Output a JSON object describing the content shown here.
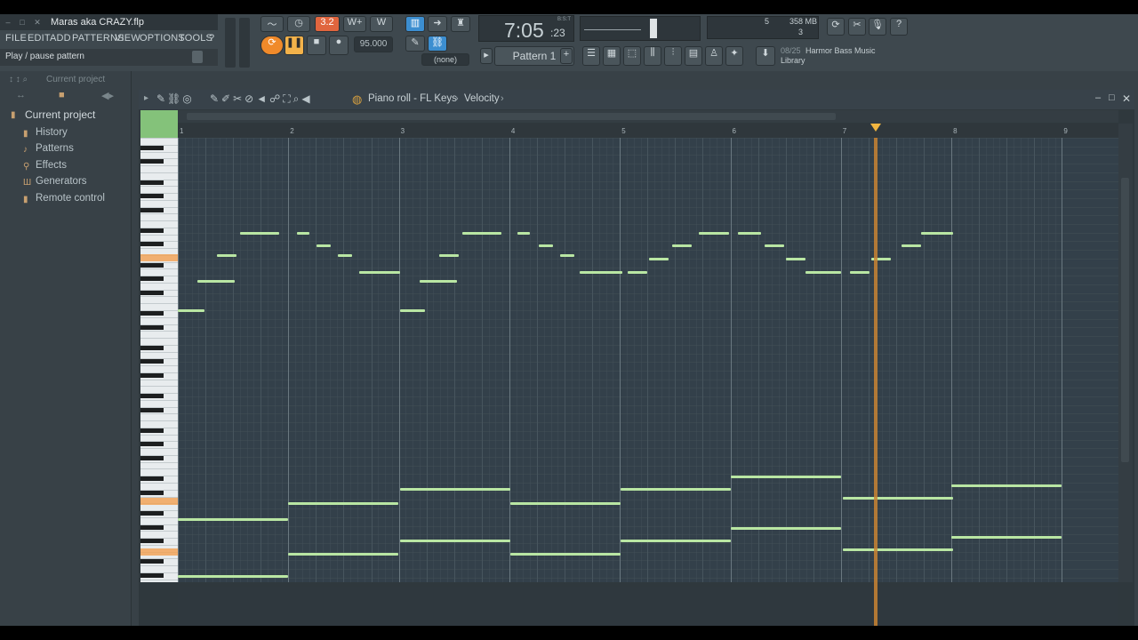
{
  "window": {
    "title": "Maras aka CRAZY.flp"
  },
  "menu": [
    "FILE",
    "EDIT",
    "ADD",
    "PATTERNS",
    "VIEW",
    "OPTIONS",
    "TOOLS",
    "?"
  ],
  "hint": "Play / pause pattern",
  "transport": {
    "tempo": "95.000",
    "time_main": "7:05",
    "time_sub": ":23",
    "time_mode": "B:S:T",
    "pattern": "Pattern 1",
    "none_label": "(none)",
    "rec_mode": "3.2"
  },
  "memory": {
    "value": "358 MB",
    "cpu": "5",
    "polyphony": "3"
  },
  "news": {
    "date": "08/25",
    "line1": "Harmor Bass Music",
    "line2": "Library"
  },
  "browser": {
    "header": "Current project",
    "root": "Current project",
    "items": [
      "History",
      "Patterns",
      "Effects",
      "Generators",
      "Remote control"
    ]
  },
  "pianoroll": {
    "title_parts": [
      "Piano roll - FL Keys",
      "Velocity"
    ],
    "bars": [
      "1",
      "2",
      "3",
      "4",
      "5",
      "6",
      "7",
      "8",
      "9"
    ],
    "playhead_bar": 7.3
  },
  "colors": {
    "note": "#b9e6a3",
    "playhead": "#c98432",
    "accent": "#f2b640",
    "key_highlight": "#f2a050"
  }
}
